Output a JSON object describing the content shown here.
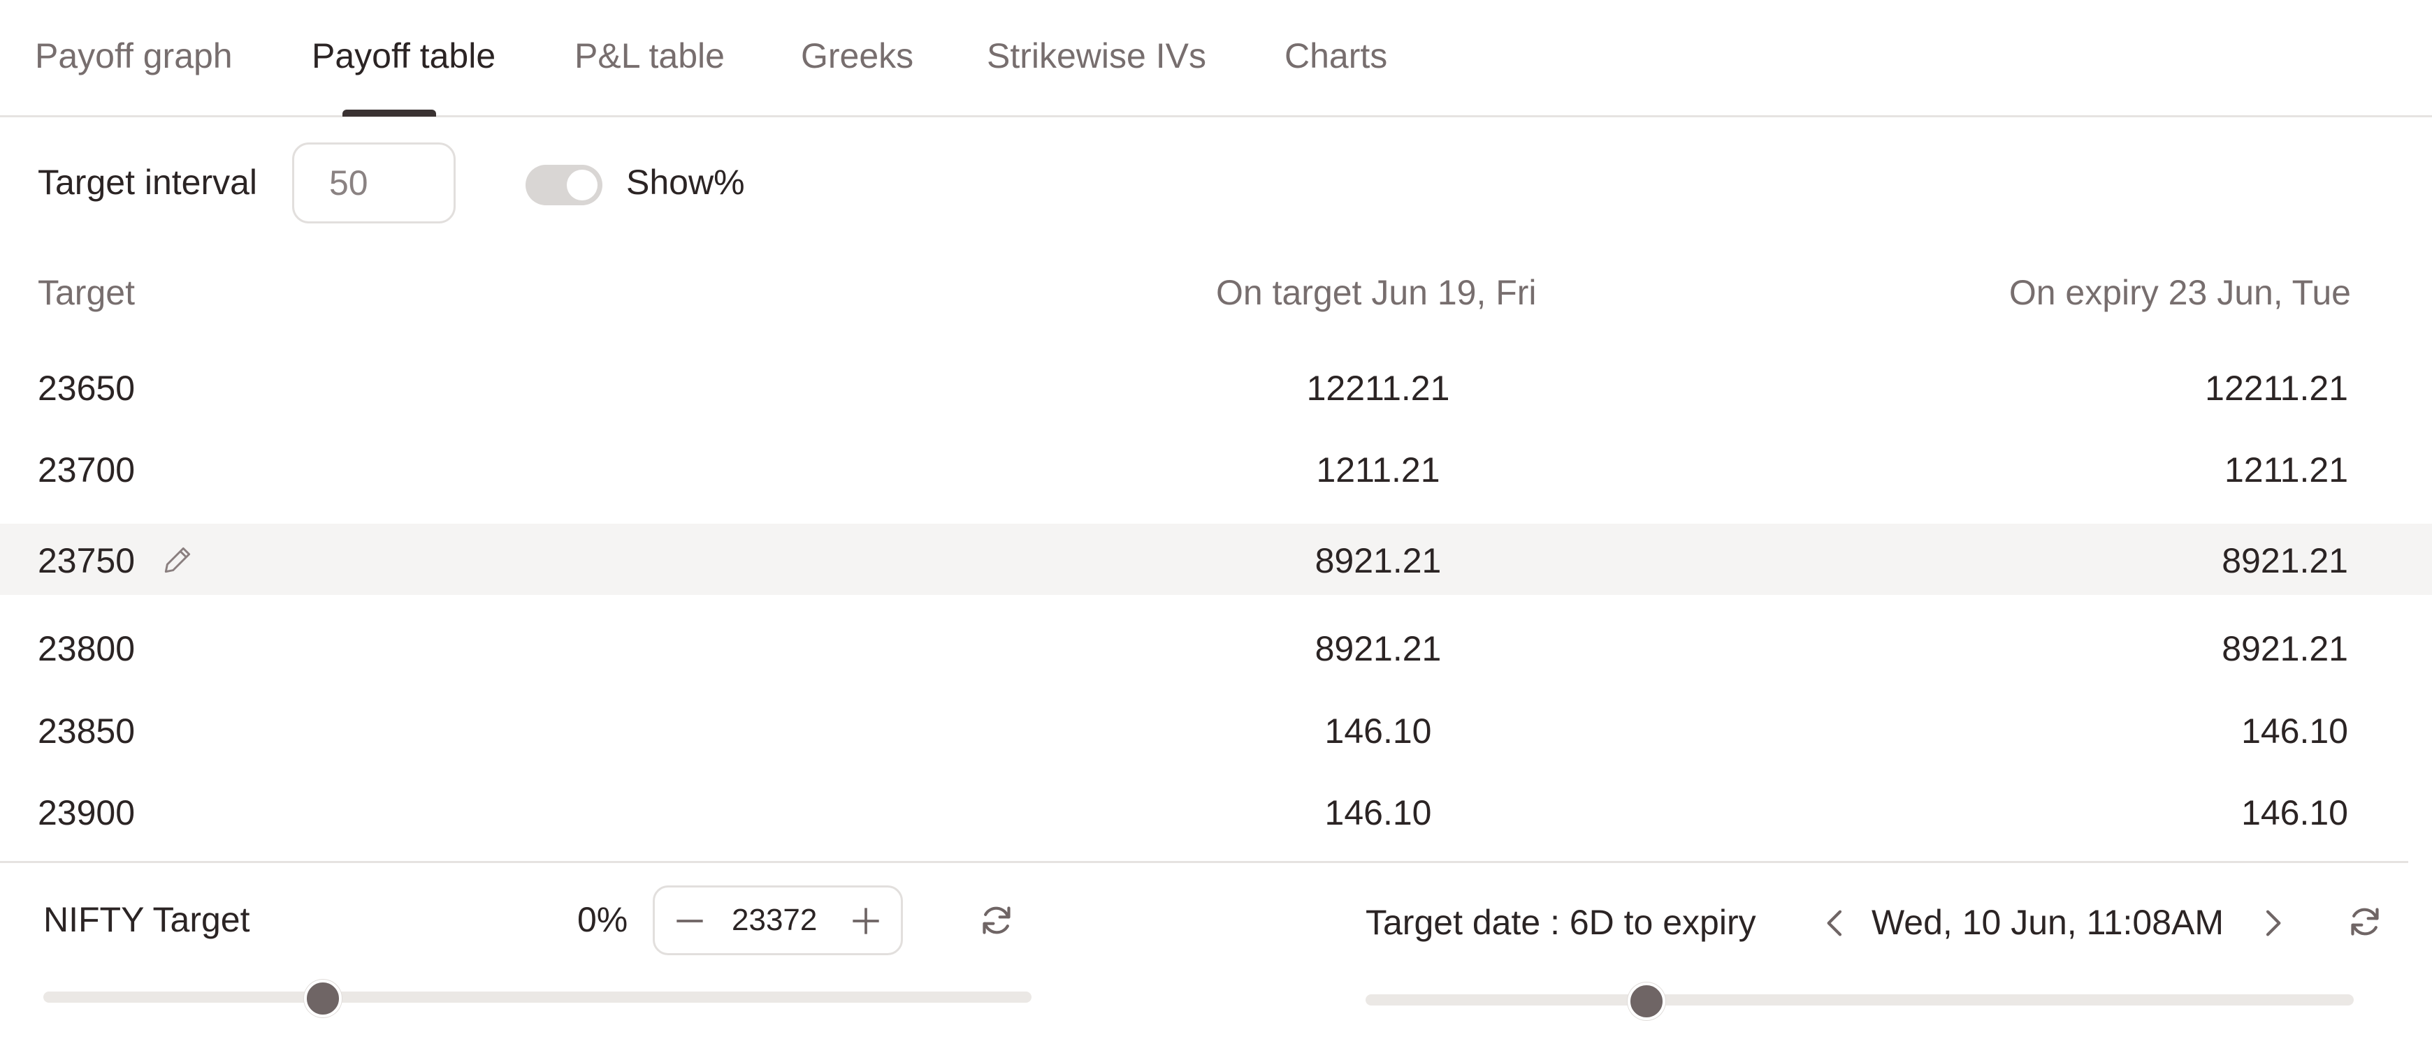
{
  "tabs": [
    {
      "label": "Payoff graph",
      "active": false
    },
    {
      "label": "Payoff table",
      "active": true
    },
    {
      "label": "P&L table",
      "active": false
    },
    {
      "label": "Greeks",
      "active": false
    },
    {
      "label": "Strikewise IVs",
      "active": false
    },
    {
      "label": "Charts",
      "active": false
    }
  ],
  "controls": {
    "target_interval_label": "Target interval",
    "target_interval_value": "50",
    "show_percent_label": "Show%",
    "show_percent_on": true
  },
  "table": {
    "headers": [
      "Target",
      "On target Jun 19, Fri",
      "On expiry 23 Jun, Tue"
    ],
    "rows": [
      {
        "target": "23650",
        "on_target": "12211.21",
        "on_expiry": "12211.21",
        "highlight": false
      },
      {
        "target": "23700",
        "on_target": "1211.21",
        "on_expiry": "1211.21",
        "highlight": false
      },
      {
        "target": "23750",
        "on_target": "8921.21",
        "on_expiry": "8921.21",
        "highlight": true
      },
      {
        "target": "23800",
        "on_target": "8921.21",
        "on_expiry": "8921.21",
        "highlight": false
      },
      {
        "target": "23850",
        "on_target": "146.10",
        "on_expiry": "146.10",
        "highlight": false
      },
      {
        "target": "23900",
        "on_target": "146.10",
        "on_expiry": "146.10",
        "highlight": false
      }
    ]
  },
  "nifty": {
    "label": "NIFTY Target",
    "percent": "0%",
    "value": "23372",
    "slider_fraction": 0.283
  },
  "target_date": {
    "label": "Target date : 6D to expiry",
    "value": "Wed, 10 Jun, 11:08AM",
    "slider_fraction": 0.284
  },
  "icons": {
    "edit": "pencil-icon",
    "decrement": "minus-icon",
    "increment": "plus-icon",
    "reset": "refresh-icon",
    "prev": "chevron-left-icon",
    "next": "chevron-right-icon"
  },
  "colors": {
    "text": "#2b2424",
    "muted": "#776e6e",
    "highlight_row": "#f5f4f3",
    "slider_thumb": "#6f6565",
    "slider_track": "#ebe8e5"
  }
}
